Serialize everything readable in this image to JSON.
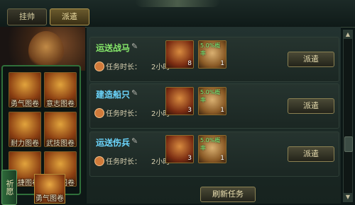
{
  "tabs": [
    {
      "label": "挂帅",
      "active": false
    },
    {
      "label": "派遣",
      "active": true
    }
  ],
  "scroll_grid": [
    {
      "label": "勇气图卷",
      "icon": "courage-scroll-icon"
    },
    {
      "label": "意志图卷",
      "icon": "will-scroll-icon"
    },
    {
      "label": "耐力图卷",
      "icon": "endurance-scroll-icon"
    },
    {
      "label": "武技图卷",
      "icon": "martial-scroll-icon"
    },
    {
      "label": "迅捷图卷",
      "icon": "swift-scroll-icon"
    },
    {
      "label": "随机图卷",
      "icon": "random-scroll-icon"
    }
  ],
  "pray": {
    "label": "祈愿",
    "card_label": "勇气图卷"
  },
  "tasks": [
    {
      "name": "运送战马",
      "name_color": "#86e86a",
      "duration_label": "任务时长：",
      "duration_value": "2小时",
      "reward_count": "8",
      "chance": "5.0%概率",
      "chance_count": "1",
      "button": "派遣"
    },
    {
      "name": "建造船只",
      "name_color": "#6cd7ff",
      "duration_label": "任务时长：",
      "duration_value": "2小时",
      "reward_count": "3",
      "chance": "5.0%概率",
      "chance_count": "1",
      "button": "派遣"
    },
    {
      "name": "运送伤兵",
      "name_color": "#6cd7ff",
      "duration_label": "任务时长：",
      "duration_value": "2小时",
      "reward_count": "3",
      "chance": "5.0%概率",
      "chance_count": "1",
      "button": "派遣"
    }
  ],
  "refresh_label": "刷新任务"
}
